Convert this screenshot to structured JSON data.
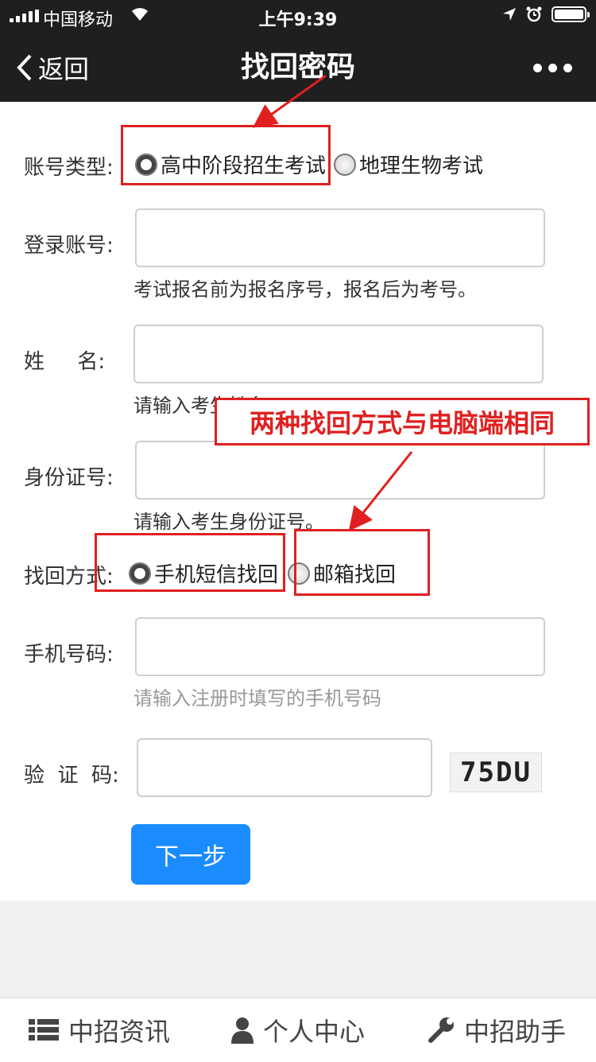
{
  "status_bar": {
    "carrier": "中国移动",
    "time": "上午9:39"
  },
  "nav": {
    "back_label": "返回",
    "title": "找回密码"
  },
  "form": {
    "account_type": {
      "label": "账号类型:",
      "options": [
        "高中阶段招生考试",
        "地理生物考试"
      ],
      "selected": "高中阶段招生考试"
    },
    "login_account": {
      "label": "登录账号:",
      "value": "",
      "hint": "考试报名前为报名序号，报名后为考号。"
    },
    "name": {
      "label": "姓     名:",
      "value": "",
      "hint": "请输入考生姓名。"
    },
    "id_number": {
      "label": "身份证号:",
      "value": "",
      "hint": "请输入考生身份证号。"
    },
    "recover_method": {
      "label": "找回方式:",
      "options": [
        "手机短信找回",
        "邮箱找回"
      ],
      "selected": "手机短信找回"
    },
    "phone": {
      "label": "手机号码:",
      "value": "",
      "placeholder": "请输入注册时填写的手机号码"
    },
    "captcha": {
      "label": "验  证  码:",
      "value": "",
      "image_text": "75DU"
    },
    "next_button": "下一步"
  },
  "annotation": {
    "text": "两种找回方式与电脑端相同",
    "color": "#e02020"
  },
  "tabbar": {
    "items": [
      "中招资讯",
      "个人中心",
      "中招助手"
    ]
  },
  "colors": {
    "primary": "#1a8cff",
    "topbar": "#1f1f1f",
    "annotation": "#e02020"
  }
}
